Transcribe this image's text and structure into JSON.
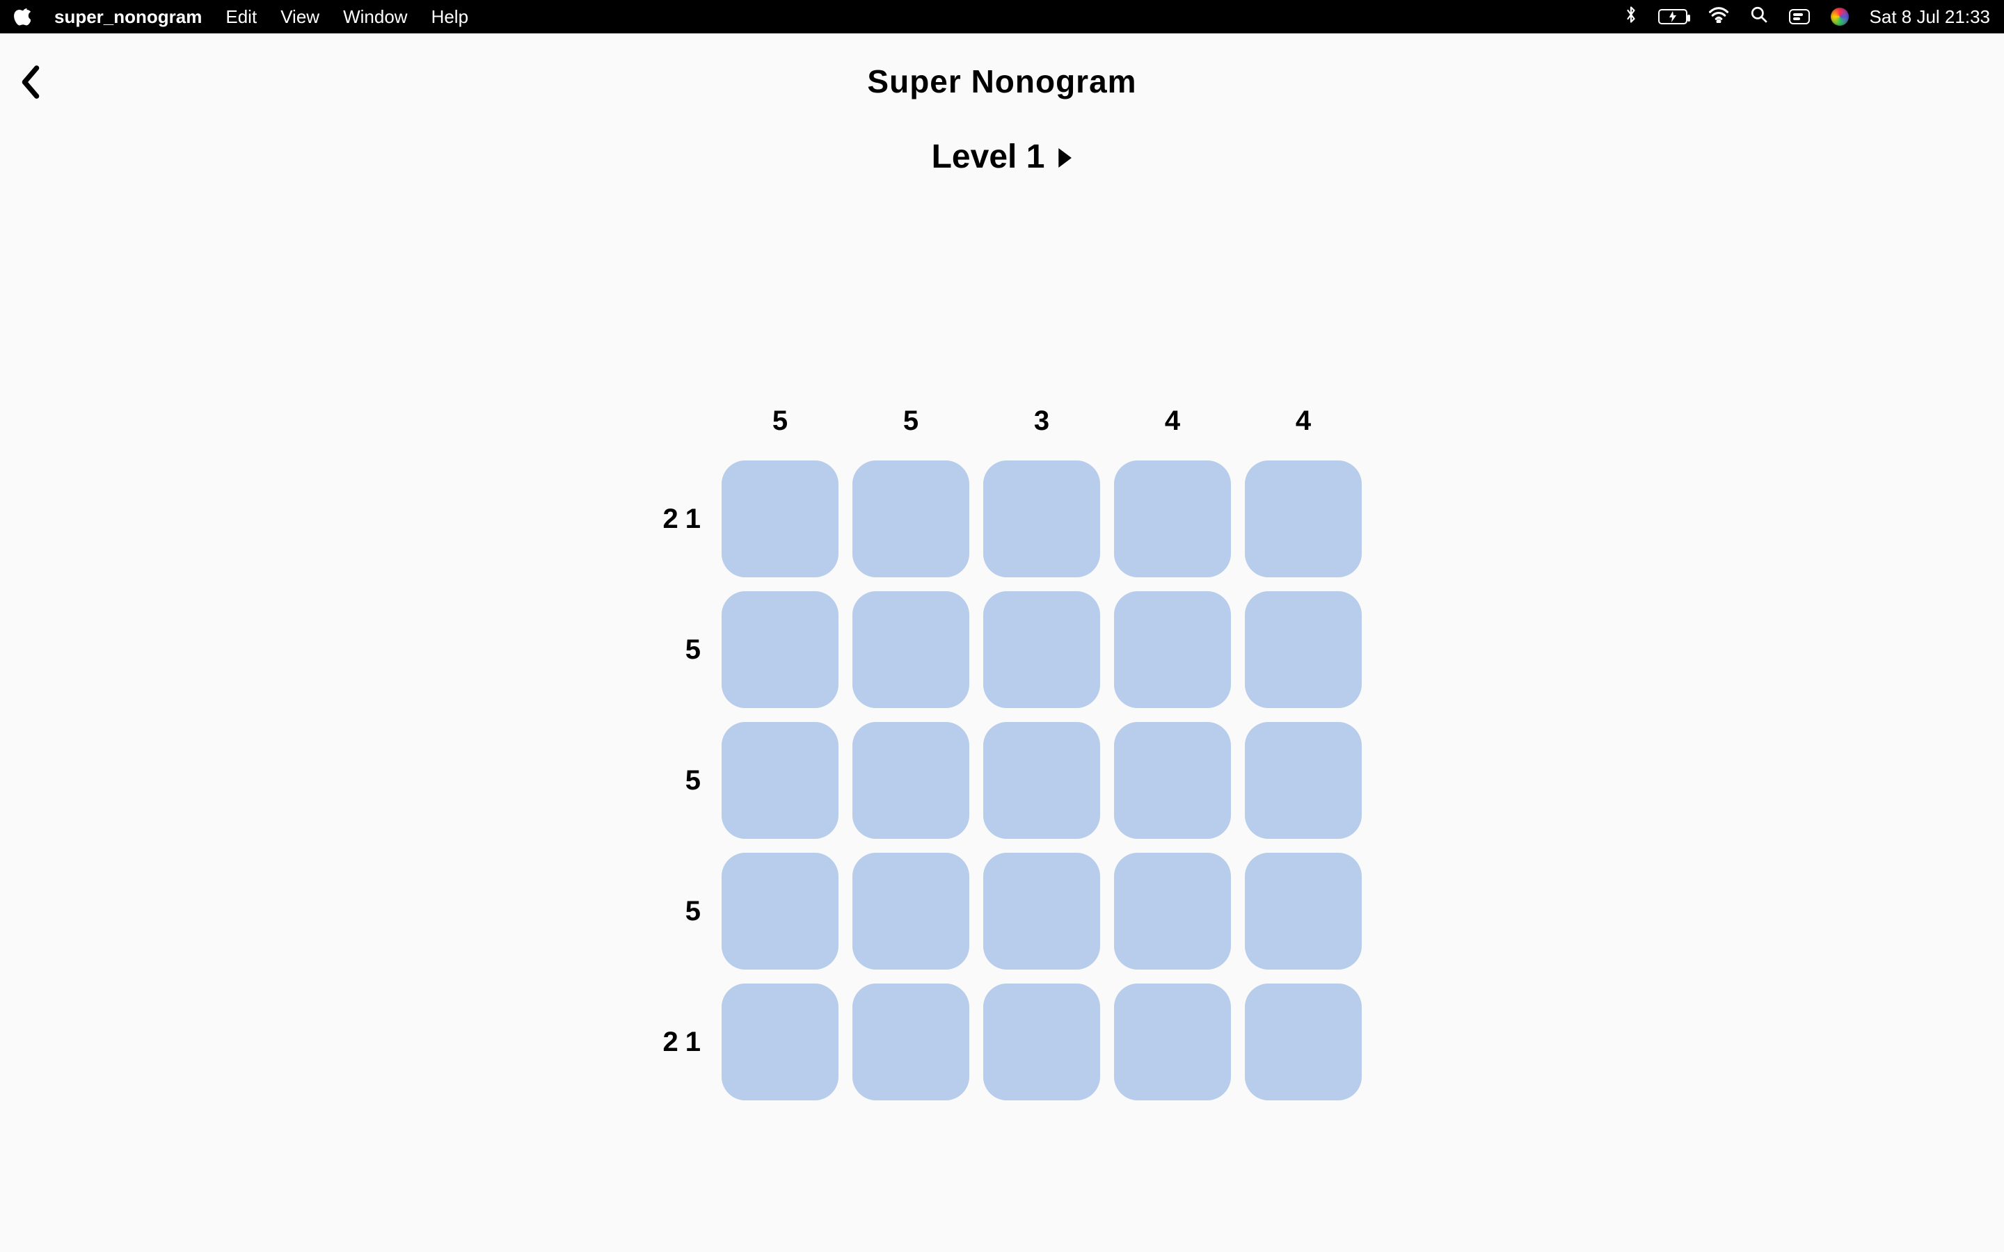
{
  "menubar": {
    "app_name": "super_nonogram",
    "items": [
      "Edit",
      "View",
      "Window",
      "Help"
    ],
    "clock": "Sat 8 Jul  21:33"
  },
  "game": {
    "title": "Super Nonogram",
    "level_label": "Level 1",
    "grid_size": 5,
    "column_hints": [
      "5",
      "5",
      "3",
      "4",
      "4"
    ],
    "row_hints": [
      [
        "2",
        "1"
      ],
      [
        "5"
      ],
      [
        "5"
      ],
      [
        "5"
      ],
      [
        "2",
        "1"
      ]
    ],
    "cell_color": "#b7cdeb"
  }
}
